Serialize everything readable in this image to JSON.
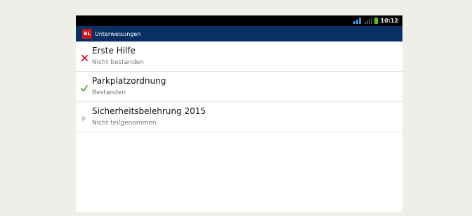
{
  "status_bar": {
    "time": "10:12"
  },
  "app": {
    "title": "Unterweisungen",
    "logo_text": "BL"
  },
  "items": [
    {
      "title": "Erste Hilfe",
      "status": "Nicht bestanden",
      "icon": "cross-icon",
      "color": "#d9161e"
    },
    {
      "title": "Parkplatzordnung",
      "status": "Bestanden",
      "icon": "check-icon",
      "color": "#4caa32"
    },
    {
      "title": "Sicherheitsbelehrung 2015",
      "status": "Nicht teilgenommen",
      "icon": "play-icon",
      "color": "#c8c8c8"
    }
  ]
}
